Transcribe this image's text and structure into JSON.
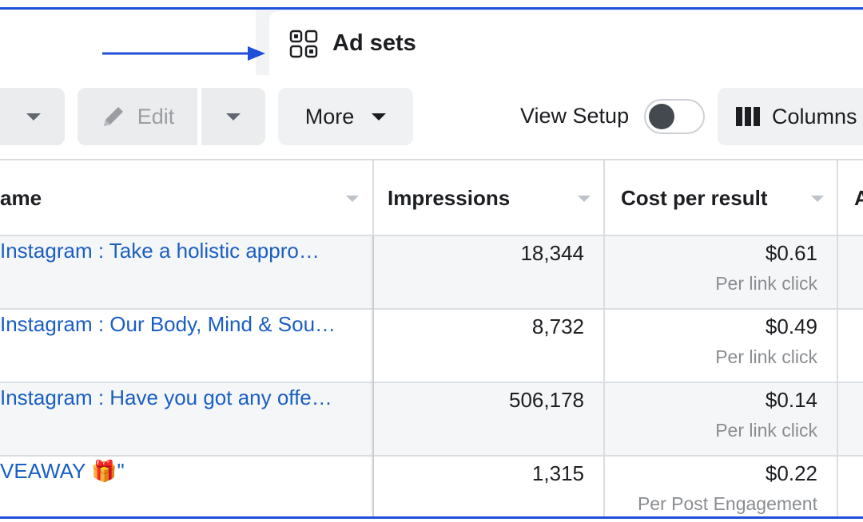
{
  "tab": {
    "title": "Ad sets",
    "icon": "grid-icon"
  },
  "toolbar": {
    "edit_label": "Edit",
    "more_label": "More",
    "view_setup_label": "View Setup",
    "view_setup_on": false,
    "columns_label": "Columns"
  },
  "table": {
    "headers": {
      "name": "ame",
      "impressions": "Impressions",
      "cost_per_result": "Cost per result",
      "next": "A"
    },
    "rows": [
      {
        "name": "Instagram : Take a holistic appro…",
        "impressions": "18,344",
        "cost": "$0.61",
        "cost_type": "Per link click"
      },
      {
        "name": "Instagram : Our Body, Mind & Sou…",
        "impressions": "8,732",
        "cost": "$0.49",
        "cost_type": "Per link click"
      },
      {
        "name": "Instagram : Have you got any offe…",
        "impressions": "506,178",
        "cost": "$0.14",
        "cost_type": "Per link click"
      },
      {
        "name": "VEAWAY 🎁\"",
        "impressions": "1,315",
        "cost": "$0.22",
        "cost_type": "Per Post Engagement"
      }
    ]
  },
  "colors": {
    "accent": "#1f4fd8",
    "link": "#1a5fc2",
    "button_bg": "#ebecee",
    "row_alt": "#f5f6f7"
  }
}
